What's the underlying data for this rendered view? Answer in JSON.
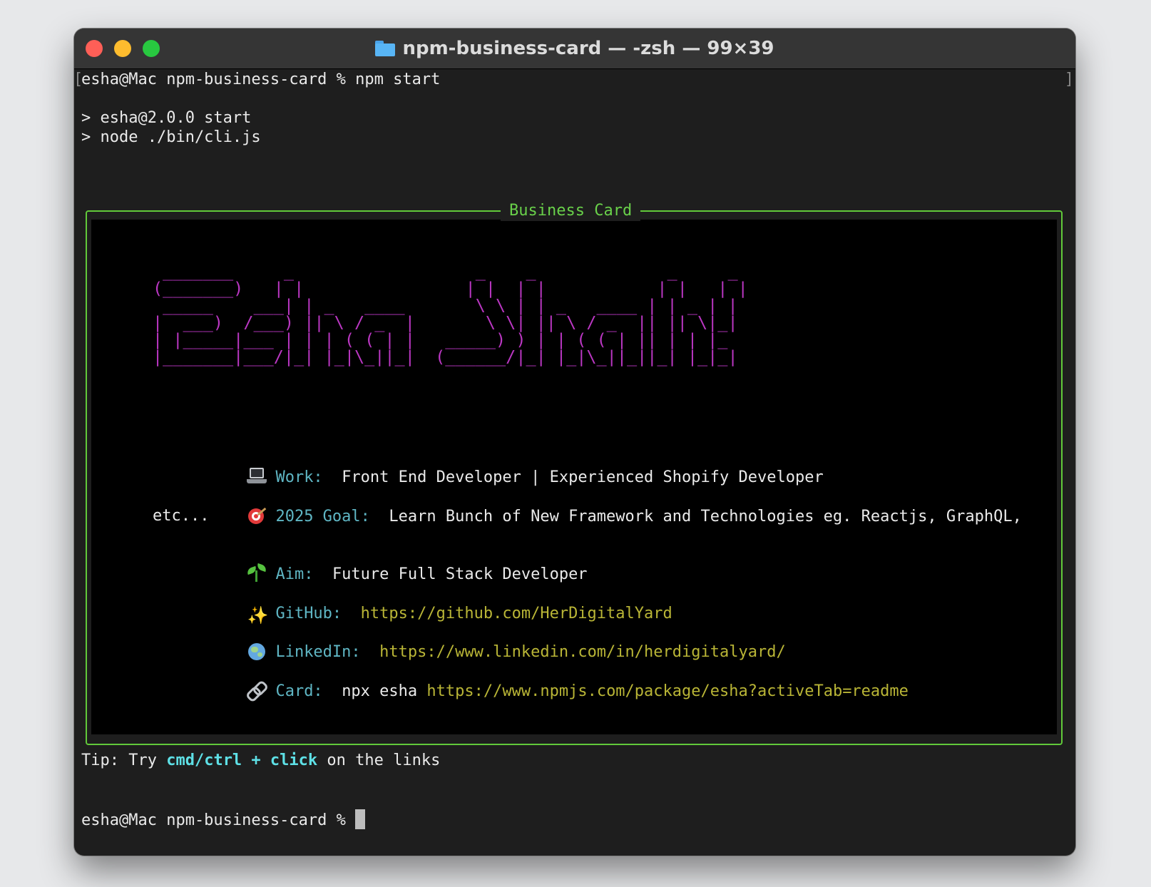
{
  "window": {
    "title": "npm-business-card — -zsh — 99×39"
  },
  "terminal": {
    "command_line": "esha@Mac npm-business-card % npm start",
    "script_lines": [
      "> esha@2.0.0 start",
      "> node ./bin/cli.js"
    ],
    "card": {
      "label": "Business Card",
      "ascii_art": " _______     _                  _    _             _     _\n(_______)   | |                | |  | |           | |   | |\n _____    ___| | _   ____       \\ \\ | | _   ____ | | _ | |\n|  ___)  /___) || \\ / _  |       \\ \\| || \\ / _  || || \\|_|\n| |_____|___ | | | ( ( | |   _____) ) | | ( ( | || | | |_\n|_______|___/|_| |_|\\_||_|  (______/|_| |_|\\_||_||_| |_|_|",
      "rows": [
        {
          "icon": "laptop-icon",
          "label": "Work:",
          "value": "Front End Developer | Experienced Shopify Developer"
        },
        {
          "icon": "target-icon",
          "label": "2025 Goal:",
          "value": "Learn Bunch of New Framework and Technologies eg. Reactjs, GraphQL,",
          "continuation": "etc..."
        },
        {
          "icon": "seedling-icon",
          "label": "Aim:",
          "value": "Future Full Stack Developer"
        },
        {
          "icon": "sparkles-icon",
          "label": "GitHub:",
          "link": "https://github.com/HerDigitalYard"
        },
        {
          "icon": "globe-icon",
          "label": "LinkedIn:",
          "link": "https://www.linkedin.com/in/herdigitalyard/"
        },
        {
          "icon": "link-icon",
          "label": "Card:",
          "value": "npx esha",
          "link": "https://www.npmjs.com/package/esha?activeTab=readme"
        }
      ]
    },
    "tip": {
      "prefix": "Tip: Try",
      "emphasis": "cmd/ctrl + click",
      "suffix": "on the links"
    },
    "prompt": "esha@Mac npm-business-card %"
  },
  "colors": {
    "border": "#61c93a",
    "ascii": "#bb37c3",
    "label": "#5fb6c4",
    "link": "#b9b536",
    "tip": "#5ee0e6"
  }
}
